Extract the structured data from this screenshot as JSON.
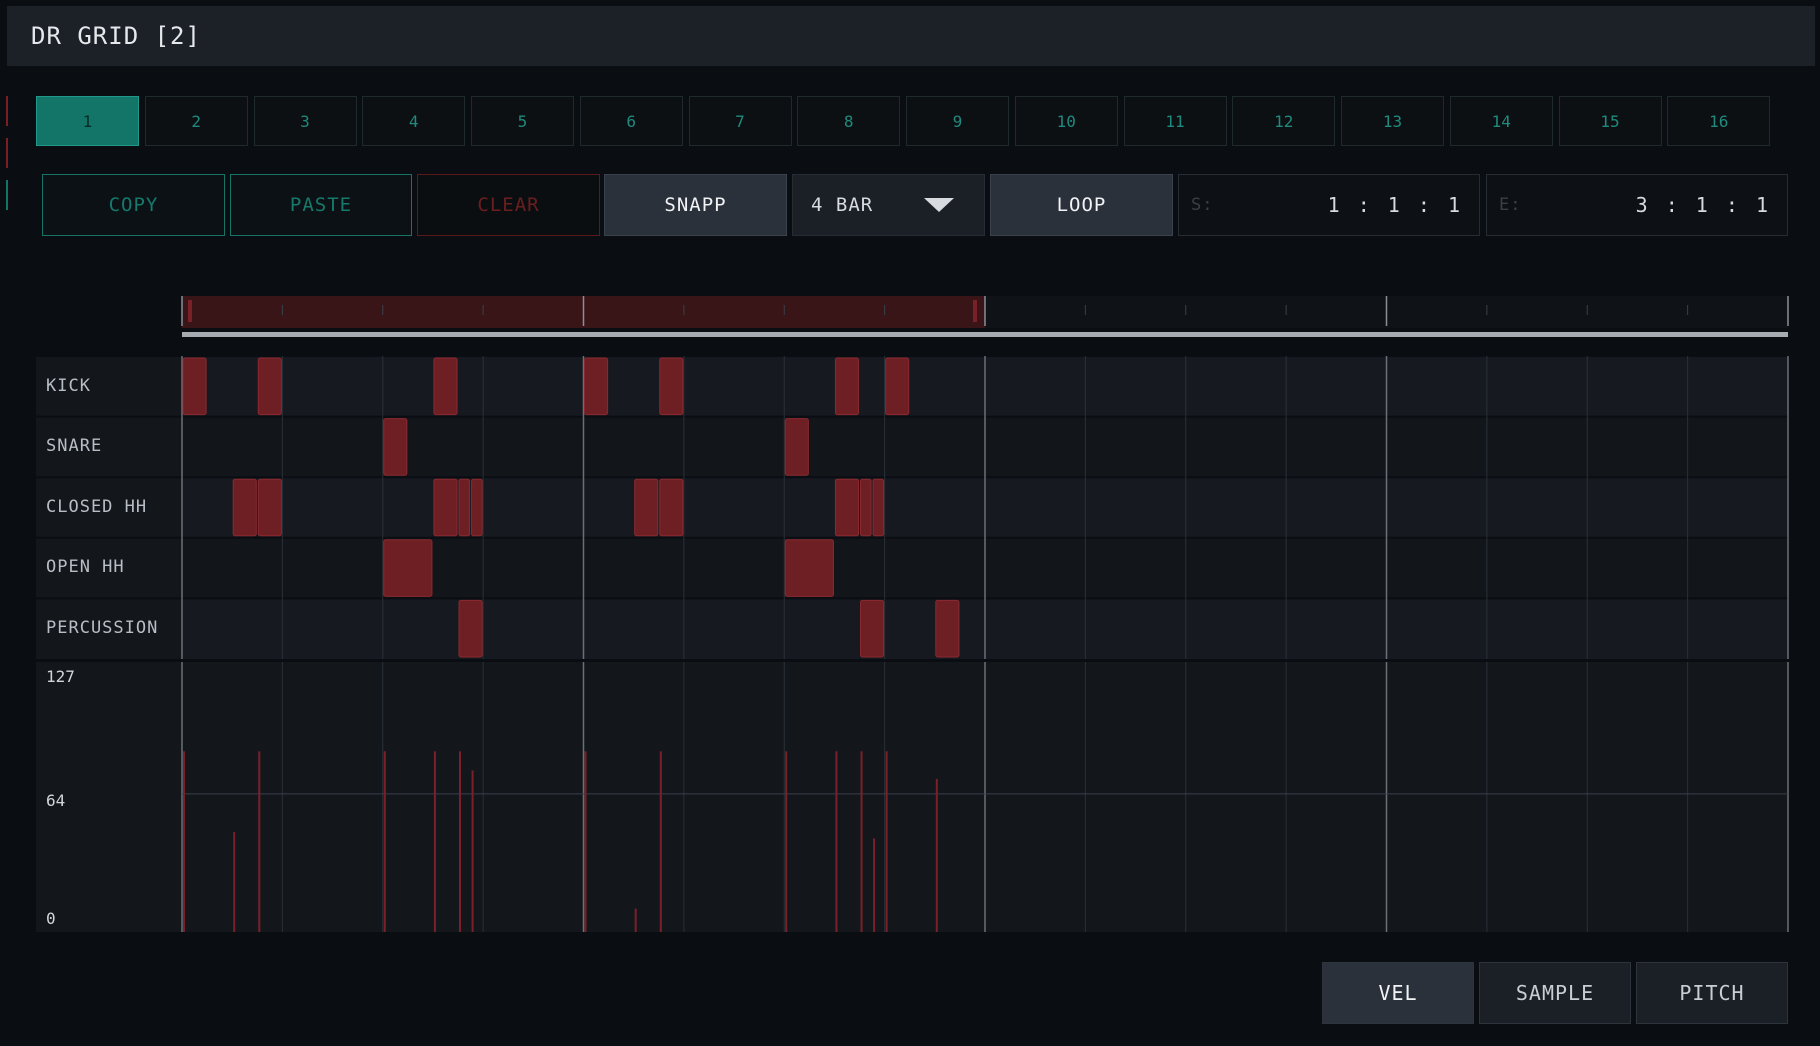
{
  "window": {
    "title": "DR GRID [2]"
  },
  "patterns": {
    "active": "1",
    "items": [
      "1",
      "2",
      "3",
      "4",
      "5",
      "6",
      "7",
      "8",
      "9",
      "10",
      "11",
      "12",
      "13",
      "14",
      "15",
      "16"
    ]
  },
  "toolbar": {
    "copy_label": "COPY",
    "paste_label": "PASTE",
    "clear_label": "CLEAR",
    "snap_label": "SNAPP",
    "length_select": "4 BAR",
    "loop_label": "LOOP",
    "start_label": "S:",
    "start_value": "1 : 1 : 1",
    "end_label": "E:",
    "end_value": "3 : 1 : 1"
  },
  "timeline": {
    "loop_start_step": 0,
    "loop_end_step": 32,
    "total_steps": 64
  },
  "lanes": [
    {
      "label": "KICK"
    },
    {
      "label": "SNARE"
    },
    {
      "label": "CLOSED HH"
    },
    {
      "label": "OPEN HH"
    },
    {
      "label": "PERCUSSION"
    }
  ],
  "notes": [
    {
      "lane": 0,
      "step": 0,
      "len": 1
    },
    {
      "lane": 0,
      "step": 3,
      "len": 1
    },
    {
      "lane": 0,
      "step": 10,
      "len": 1
    },
    {
      "lane": 0,
      "step": 16,
      "len": 1
    },
    {
      "lane": 0,
      "step": 19,
      "len": 1
    },
    {
      "lane": 0,
      "step": 26,
      "len": 1
    },
    {
      "lane": 0,
      "step": 28,
      "len": 1
    },
    {
      "lane": 1,
      "step": 8,
      "len": 1
    },
    {
      "lane": 1,
      "step": 24,
      "len": 1
    },
    {
      "lane": 2,
      "step": 2,
      "len": 1
    },
    {
      "lane": 2,
      "step": 3,
      "len": 1
    },
    {
      "lane": 2,
      "step": 10,
      "len": 1
    },
    {
      "lane": 2,
      "step": 11,
      "len": 0.5
    },
    {
      "lane": 2,
      "step": 11.5,
      "len": 0.5
    },
    {
      "lane": 2,
      "step": 18,
      "len": 1
    },
    {
      "lane": 2,
      "step": 19,
      "len": 1
    },
    {
      "lane": 2,
      "step": 26,
      "len": 1
    },
    {
      "lane": 2,
      "step": 27,
      "len": 0.5
    },
    {
      "lane": 2,
      "step": 27.5,
      "len": 0.5
    },
    {
      "lane": 3,
      "step": 8,
      "len": 2
    },
    {
      "lane": 3,
      "step": 24,
      "len": 2
    },
    {
      "lane": 4,
      "step": 11,
      "len": 1
    },
    {
      "lane": 4,
      "step": 27,
      "len": 1
    },
    {
      "lane": 4,
      "step": 30,
      "len": 1
    }
  ],
  "velocity": {
    "labels": {
      "max": "127",
      "mid": "64",
      "min": "0"
    },
    "bars": [
      {
        "step": 0,
        "value": 85
      },
      {
        "step": 2,
        "value": 47
      },
      {
        "step": 3,
        "value": 85
      },
      {
        "step": 8,
        "value": 85
      },
      {
        "step": 10,
        "value": 85
      },
      {
        "step": 11,
        "value": 85
      },
      {
        "step": 11.5,
        "value": 76
      },
      {
        "step": 16,
        "value": 85
      },
      {
        "step": 18,
        "value": 11
      },
      {
        "step": 19,
        "value": 85
      },
      {
        "step": 24,
        "value": 85
      },
      {
        "step": 26,
        "value": 85
      },
      {
        "step": 27,
        "value": 85
      },
      {
        "step": 27.5,
        "value": 44
      },
      {
        "step": 28,
        "value": 85
      },
      {
        "step": 30,
        "value": 72
      }
    ]
  },
  "bottom_tabs": {
    "active": "VEL",
    "vel": "VEL",
    "sample": "SAMPLE",
    "pitch": "PITCH"
  },
  "colors": {
    "accent_teal": "#137468",
    "note_red": "#6e1f24",
    "note_border": "#8a2a30",
    "velocity_red": "#7a2028",
    "loop_region": "#3a1518"
  }
}
